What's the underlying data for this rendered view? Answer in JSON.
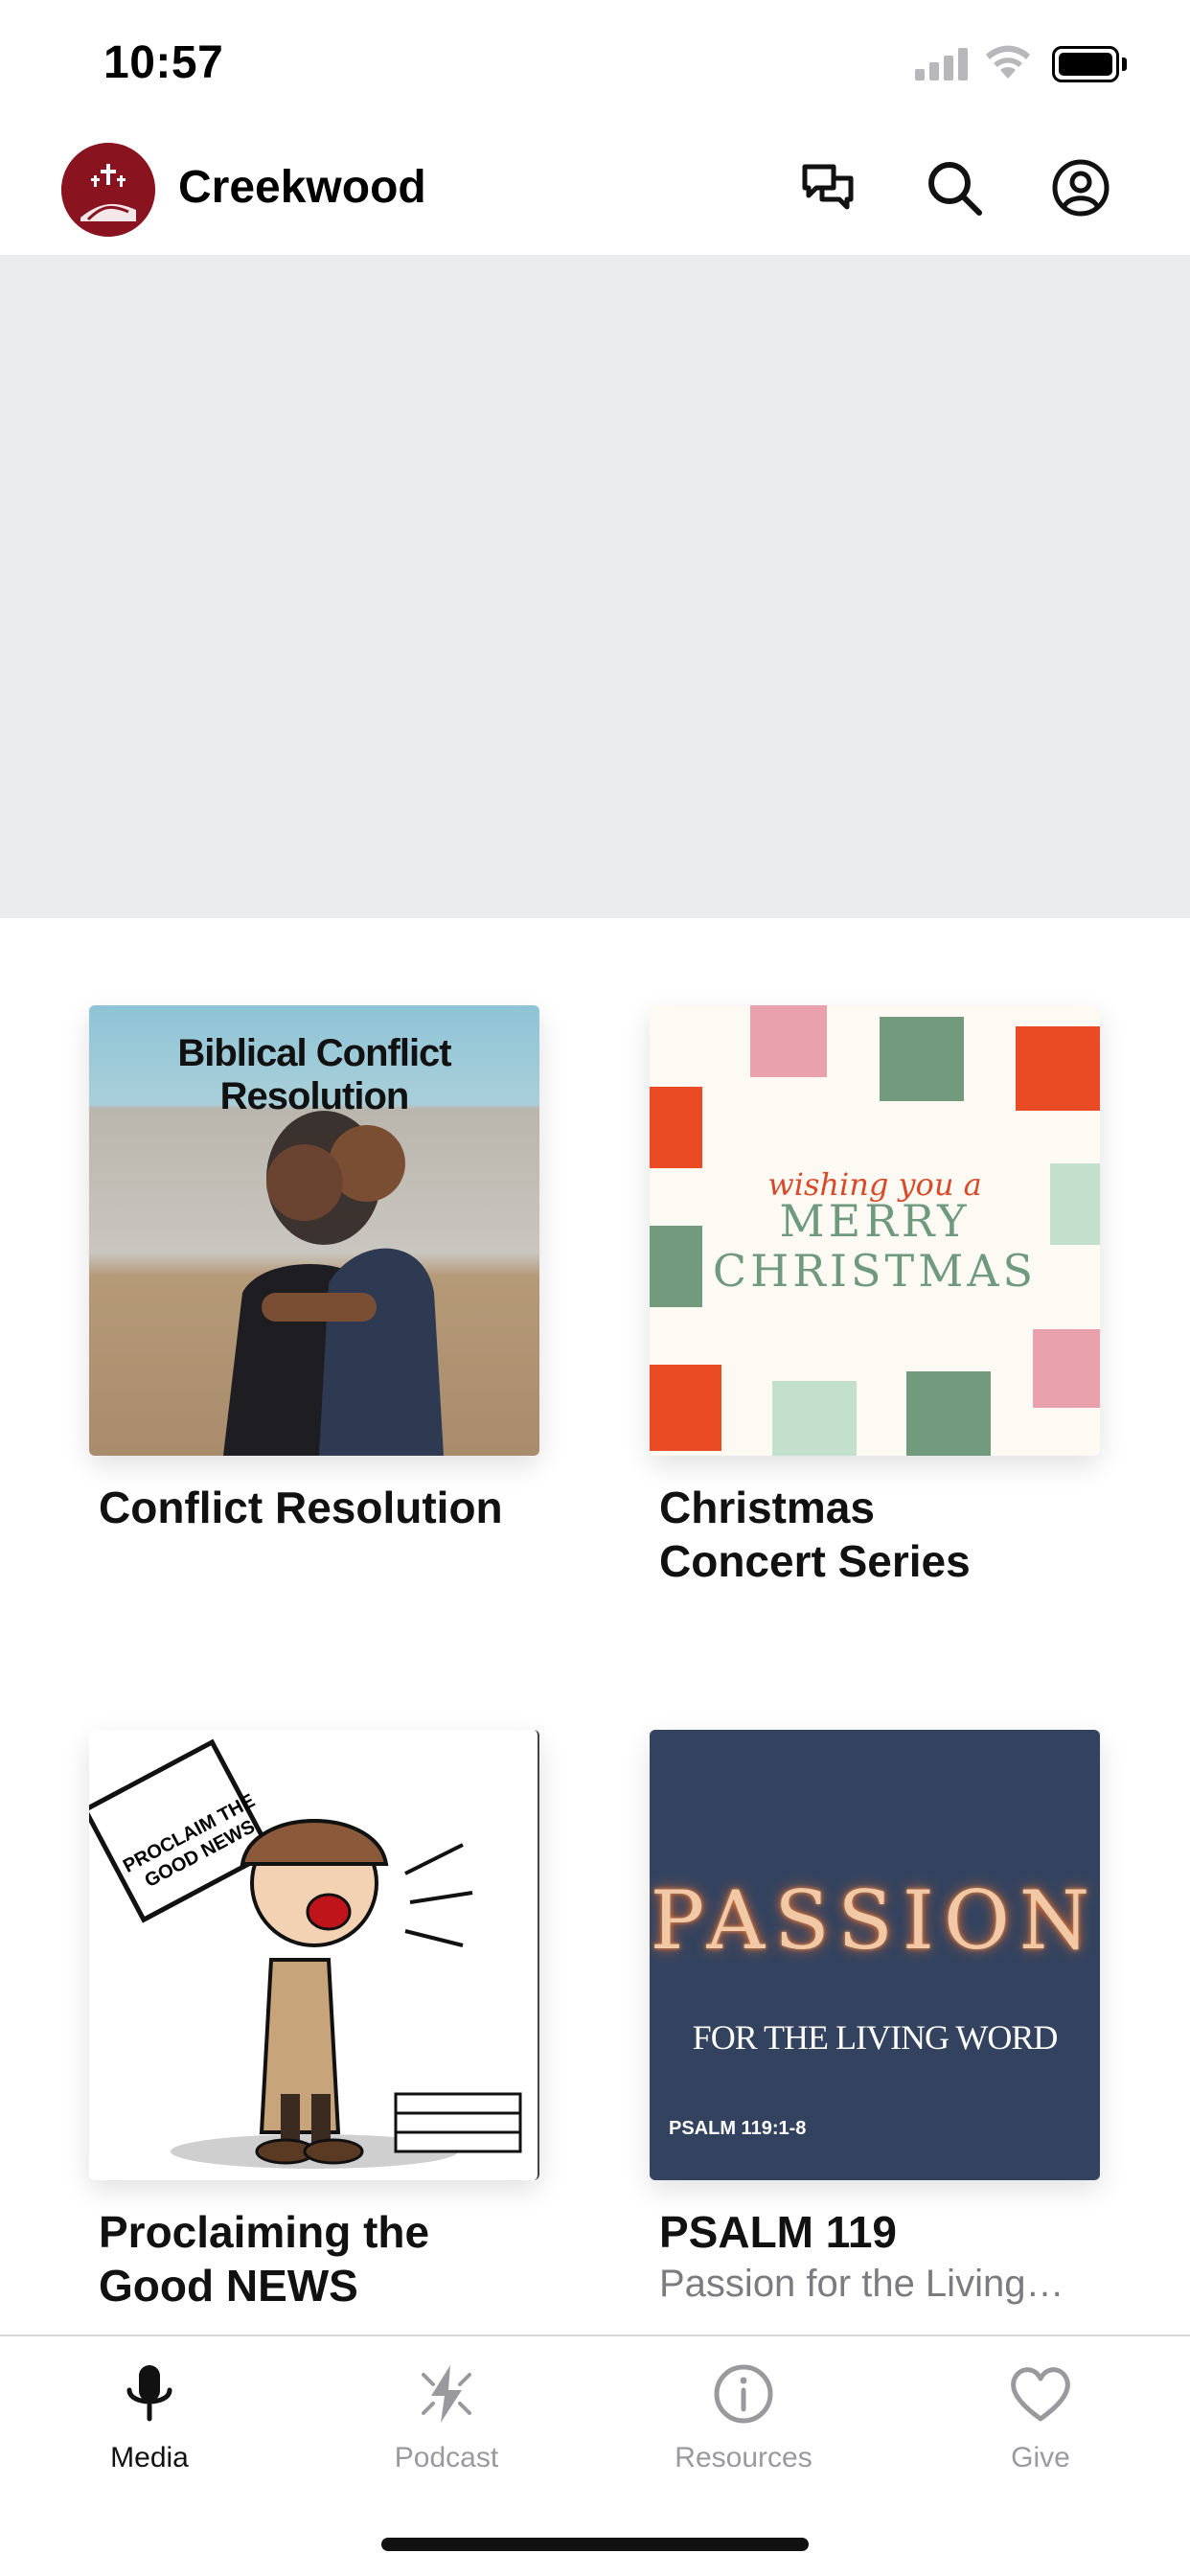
{
  "status_bar": {
    "time": "10:57"
  },
  "header": {
    "title": "Creekwood",
    "icons": [
      "chat-icon",
      "search-icon",
      "profile-icon"
    ]
  },
  "cards": [
    {
      "thumb_text": "Biblical Conflict Resolution",
      "title": "Conflict Resolution",
      "subtitle": ""
    },
    {
      "thumb_text_script": "wishing you a",
      "thumb_text_line1": "MERRY",
      "thumb_text_line2": "CHRISTMAS",
      "title_line1": "Christmas",
      "title_line2": "Concert Series",
      "subtitle": ""
    },
    {
      "thumb_text": "PROCLAIM THE GOOD NEWS",
      "title_line1": "Proclaiming the",
      "title_line2": "Good NEWS",
      "subtitle": ""
    },
    {
      "thumb_text_big": "PASSION",
      "thumb_text_mid": "FOR THE LIVING WORD",
      "thumb_text_small": "PSALM 119:1-8",
      "title": "PSALM 119",
      "subtitle": "Passion for the Living…"
    }
  ],
  "tabs": [
    {
      "label": "Media",
      "icon": "microphone-icon",
      "active": true
    },
    {
      "label": "Podcast",
      "icon": "podcast-icon",
      "active": false
    },
    {
      "label": "Resources",
      "icon": "info-icon",
      "active": false
    },
    {
      "label": "Give",
      "icon": "heart-icon",
      "active": false
    }
  ],
  "colors": {
    "brand": "#8a1320",
    "banner": "#ebecee",
    "tab_inactive": "#9a9a9e",
    "passion_bg": "#33435f"
  }
}
